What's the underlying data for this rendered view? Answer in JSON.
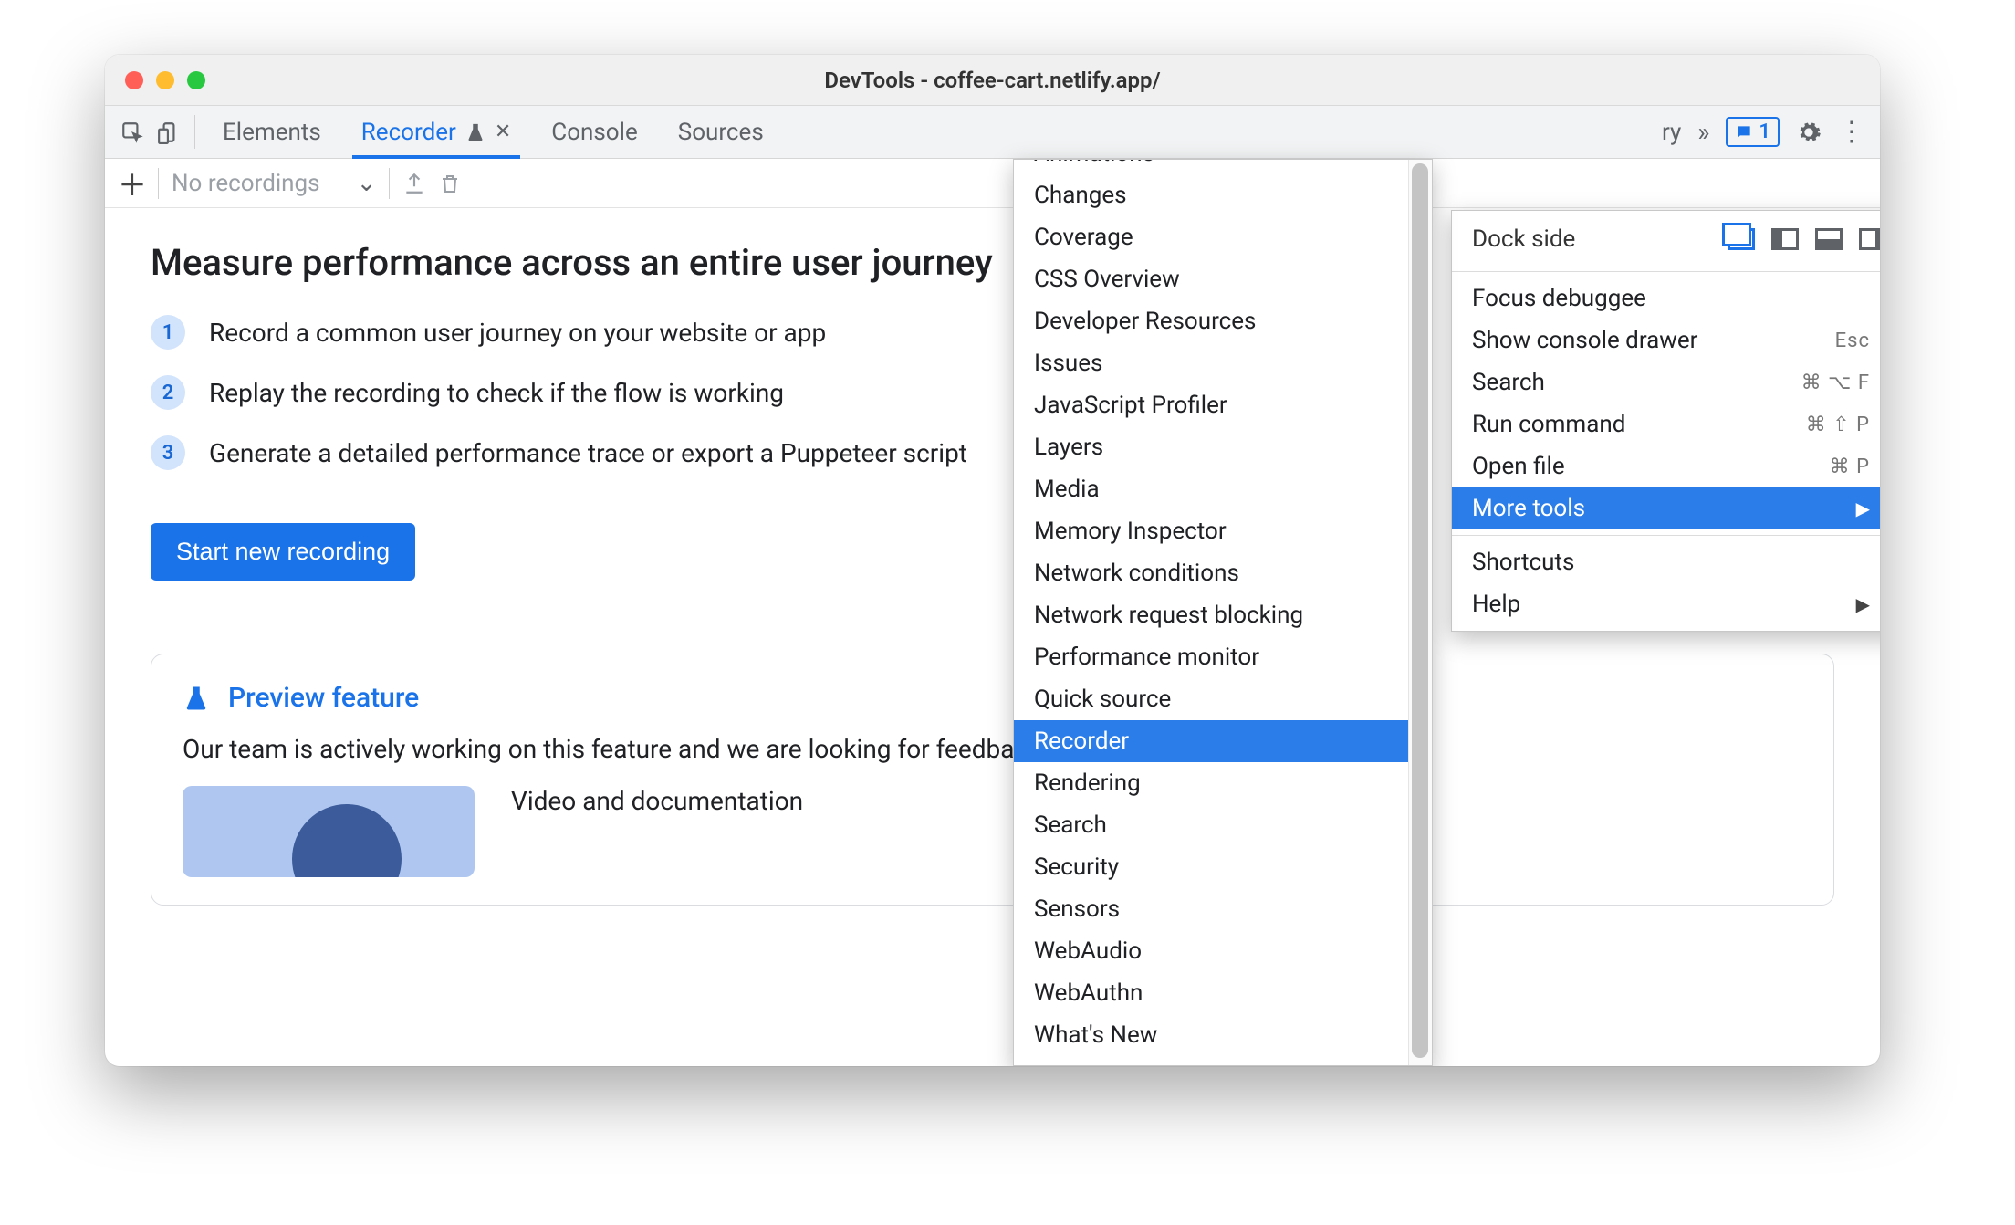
{
  "window": {
    "title": "DevTools - coffee-cart.netlify.app/"
  },
  "tabs": {
    "items": [
      "Elements",
      "Recorder",
      "Console",
      "Sources"
    ],
    "active_index": 1,
    "overflow_hint": "ry"
  },
  "issues_badge": "1",
  "subbar": {
    "dropdown_placeholder": "No recordings"
  },
  "page": {
    "heading": "Measure performance across an entire user journey",
    "steps": [
      "Record a common user journey on your website or app",
      "Replay the recording to check if the flow is working",
      "Generate a detailed performance trace or export a Puppeteer script"
    ],
    "cta": "Start new recording",
    "preview": {
      "title": "Preview feature",
      "desc": "Our team is actively working on this feature and we are looking for feedback.",
      "video_title": "Video and documentation"
    }
  },
  "main_menu": {
    "dock_label": "Dock side",
    "items": [
      {
        "label": "Focus debuggee"
      },
      {
        "label": "Show console drawer",
        "shortcut": "Esc"
      },
      {
        "label": "Search",
        "shortcut": "⌘ ⌥ F"
      },
      {
        "label": "Run command",
        "shortcut": "⌘ ⇧ P"
      },
      {
        "label": "Open file",
        "shortcut": "⌘ P"
      },
      {
        "label": "More tools",
        "submenu": true,
        "selected": true
      },
      {
        "label": "Shortcuts"
      },
      {
        "label": "Help",
        "submenu": true
      }
    ]
  },
  "more_tools": {
    "items": [
      "Animations",
      "Changes",
      "Coverage",
      "CSS Overview",
      "Developer Resources",
      "Issues",
      "JavaScript Profiler",
      "Layers",
      "Media",
      "Memory Inspector",
      "Network conditions",
      "Network request blocking",
      "Performance monitor",
      "Quick source",
      "Recorder",
      "Rendering",
      "Search",
      "Security",
      "Sensors",
      "WebAudio",
      "WebAuthn",
      "What's New"
    ],
    "selected_index": 14
  }
}
